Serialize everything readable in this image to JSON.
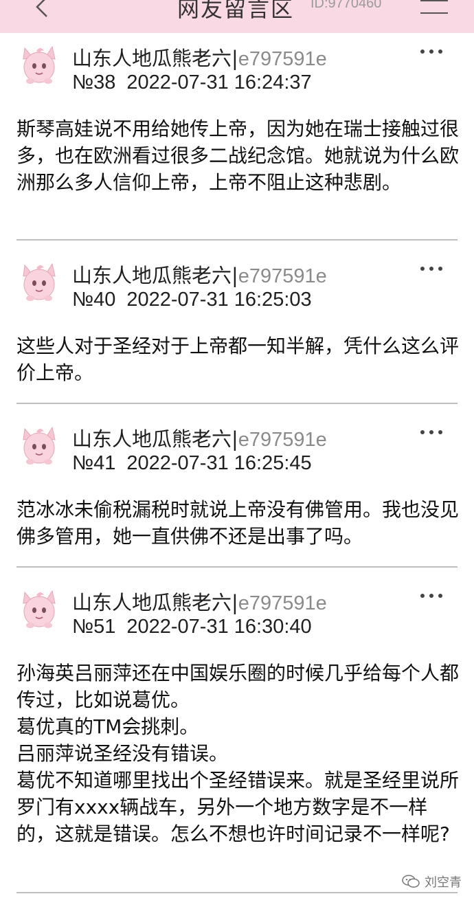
{
  "header": {
    "title": "网友留言区",
    "room_id": "ID:9770460"
  },
  "posts": [
    {
      "user": "山东人地瓜熊老六|",
      "uid": "e797591e",
      "number": "№38",
      "timestamp": "2022-07-31 16:24:37",
      "content": "斯琴高娃说不用给她传上帝，因为她在瑞士接触过很多，也在欧洲看过很多二战纪念馆。她就说为什么欧洲那么多人信仰上帝，上帝不阻止这种悲剧。"
    },
    {
      "user": "山东人地瓜熊老六|",
      "uid": "e797591e",
      "number": "№40",
      "timestamp": "2022-07-31 16:25:03",
      "content": "这些人对于圣经对于上帝都一知半解，凭什么这么评价上帝。"
    },
    {
      "user": "山东人地瓜熊老六|",
      "uid": "e797591e",
      "number": "№41",
      "timestamp": "2022-07-31 16:25:45",
      "content": "范冰冰未偷税漏税时就说上帝没有佛管用。我也没见佛多管用，她一直供佛不还是出事了吗。"
    },
    {
      "user": "山东人地瓜熊老六|",
      "uid": "e797591e",
      "number": "№51",
      "timestamp": "2022-07-31 16:30:40",
      "content": "孙海英吕丽萍还在中国娱乐圈的时候几乎给每个人都传过，比如说葛优。\n葛优真的TM会挑刺。\n吕丽萍说圣经没有错误。\n葛优不知道哪里找出个圣经错误来。就是圣经里说所罗门有xxxx辆战车，另外一个地方数字是不一样的，这就是错误。怎么不想也许时间记录不一样呢?"
    }
  ],
  "watermark": {
    "text": "刘空青"
  },
  "colors": {
    "header_bg": "#f9d9e4",
    "divider": "#bdbdbd",
    "uid_gray": "#8a8a8a"
  },
  "icons": {
    "back": "chevron-left-icon",
    "menu": "hamburger-menu-icon",
    "more": "more-dots-icon",
    "avatar": "pink-creature-avatar-icon",
    "watermark": "wechat-icon"
  }
}
